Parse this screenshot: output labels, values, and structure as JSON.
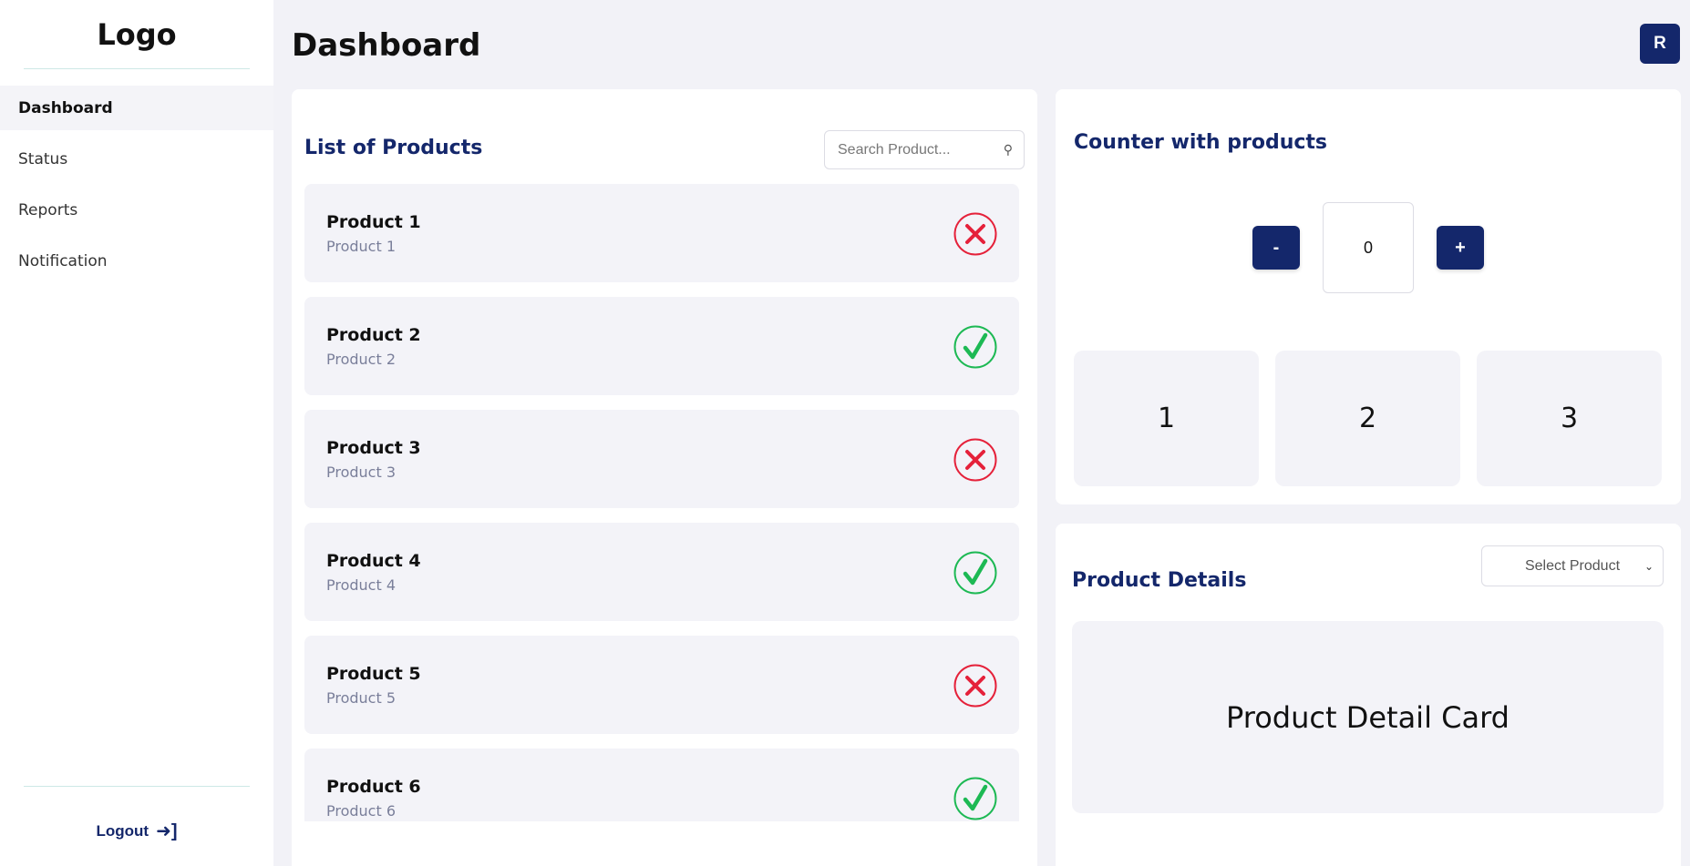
{
  "sidebar": {
    "logo": "Logo",
    "items": [
      {
        "label": "Dashboard",
        "active": true
      },
      {
        "label": "Status",
        "active": false
      },
      {
        "label": "Reports",
        "active": false
      },
      {
        "label": "Notification",
        "active": false
      }
    ],
    "logout_label": "Logout",
    "logout_icon": "logout-arrow-icon"
  },
  "header": {
    "title": "Dashboard",
    "avatar_initial": "R"
  },
  "products": {
    "title": "List of Products",
    "search_placeholder": "Search Product...",
    "items": [
      {
        "name": "Product 1",
        "subtitle": "Product 1",
        "status": "inactive"
      },
      {
        "name": "Product 2",
        "subtitle": "Product 2",
        "status": "active"
      },
      {
        "name": "Product 3",
        "subtitle": "Product 3",
        "status": "inactive"
      },
      {
        "name": "Product 4",
        "subtitle": "Product 4",
        "status": "active"
      },
      {
        "name": "Product 5",
        "subtitle": "Product 5",
        "status": "inactive"
      },
      {
        "name": "Product 6",
        "subtitle": "Product 6",
        "status": "active"
      }
    ]
  },
  "counter": {
    "title": "Counter with products",
    "minus_label": "-",
    "plus_label": "+",
    "value": "0",
    "tiles": [
      "1",
      "2",
      "3"
    ]
  },
  "details": {
    "title": "Product Details",
    "select_value": "Select Product",
    "card_text": "Product Detail Card"
  },
  "colors": {
    "brand": "#14276b",
    "background": "#f2f2f7",
    "card": "#f3f3f8",
    "status_ok": "#1db954",
    "status_error": "#e5213a"
  }
}
